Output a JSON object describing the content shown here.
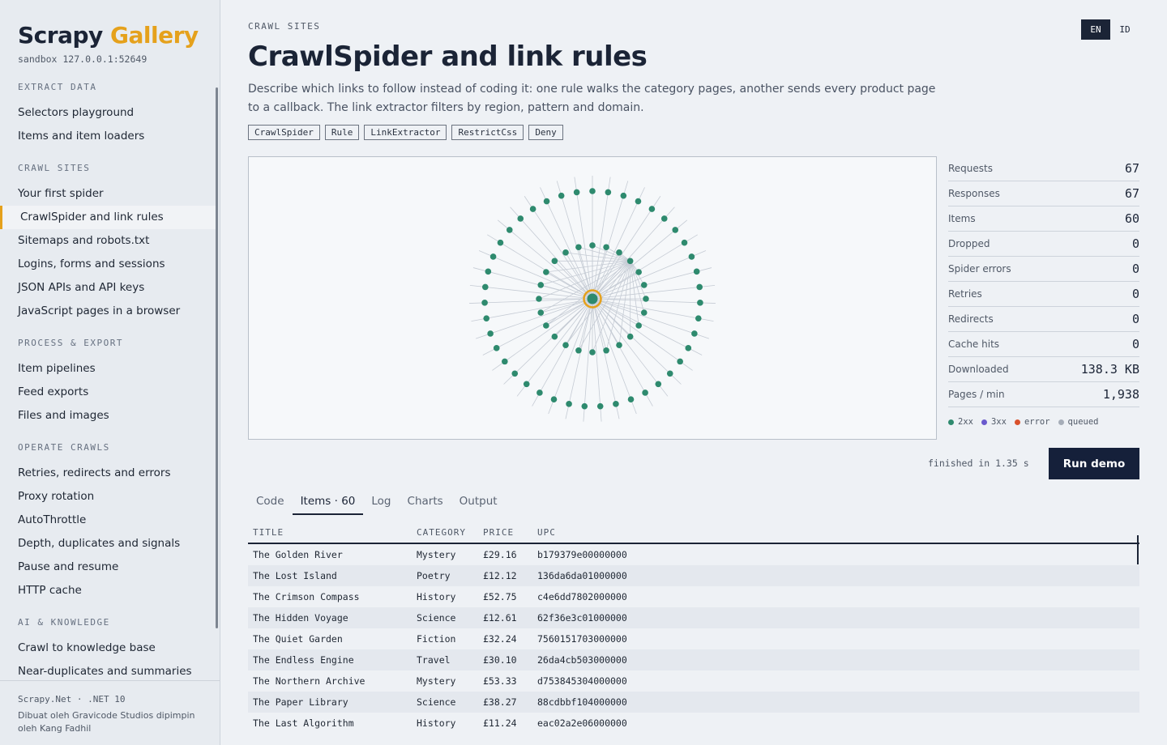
{
  "brand": {
    "name1": "Scrapy",
    "name2": "Gallery",
    "host": "sandbox 127.0.0.1:52649"
  },
  "nav": [
    {
      "section": "EXTRACT DATA",
      "items": [
        {
          "label": "Selectors playground",
          "active": false
        },
        {
          "label": "Items and item loaders",
          "active": false
        }
      ]
    },
    {
      "section": "CRAWL SITES",
      "items": [
        {
          "label": "Your first spider",
          "active": false
        },
        {
          "label": "CrawlSpider and link rules",
          "active": true
        },
        {
          "label": "Sitemaps and robots.txt",
          "active": false
        },
        {
          "label": "Logins, forms and sessions",
          "active": false
        },
        {
          "label": "JSON APIs and API keys",
          "active": false
        },
        {
          "label": "JavaScript pages in a browser",
          "active": false
        }
      ]
    },
    {
      "section": "PROCESS & EXPORT",
      "items": [
        {
          "label": "Item pipelines",
          "active": false
        },
        {
          "label": "Feed exports",
          "active": false
        },
        {
          "label": "Files and images",
          "active": false
        }
      ]
    },
    {
      "section": "OPERATE CRAWLS",
      "items": [
        {
          "label": "Retries, redirects and errors",
          "active": false
        },
        {
          "label": "Proxy rotation",
          "active": false
        },
        {
          "label": "AutoThrottle",
          "active": false
        },
        {
          "label": "Depth, duplicates and signals",
          "active": false
        },
        {
          "label": "Pause and resume",
          "active": false
        },
        {
          "label": "HTTP cache",
          "active": false
        }
      ]
    },
    {
      "section": "AI & KNOWLEDGE",
      "items": [
        {
          "label": "Crawl to knowledge base",
          "active": false
        },
        {
          "label": "Near-duplicates and summaries",
          "active": false
        }
      ]
    },
    {
      "section": "RUN AS A PLATFORM",
      "items": []
    }
  ],
  "footer": {
    "version": "Scrapy.Net · .NET 10",
    "credit": "Dibuat oleh Gravicode Studios dipimpin oleh Kang Fadhil"
  },
  "page": {
    "eyebrow": "CRAWL SITES",
    "title": "CrawlSpider and link rules",
    "description": "Describe which links to follow instead of coding it: one rule walks the category pages, another sends every product page to a callback. The link extractor filters by region, pattern and domain.",
    "tags": [
      "CrawlSpider",
      "Rule",
      "LinkExtractor",
      "RestrictCss",
      "Deny"
    ]
  },
  "lang": {
    "en": "EN",
    "id": "ID",
    "active": "EN"
  },
  "graph": {
    "inner_nodes": 24,
    "outer_nodes": 43,
    "colors": {
      "node": "#2e8a6e",
      "root_ring": "#e5a11c",
      "edge": "#c5cbd4"
    }
  },
  "stats": [
    {
      "label": "Requests",
      "value": "67"
    },
    {
      "label": "Responses",
      "value": "67"
    },
    {
      "label": "Items",
      "value": "60"
    },
    {
      "label": "Dropped",
      "value": "0"
    },
    {
      "label": "Spider errors",
      "value": "0"
    },
    {
      "label": "Retries",
      "value": "0"
    },
    {
      "label": "Redirects",
      "value": "0"
    },
    {
      "label": "Cache hits",
      "value": "0"
    },
    {
      "label": "Downloaded",
      "value": "138.3 KB"
    },
    {
      "label": "Pages / min",
      "value": "1,938"
    }
  ],
  "legend": [
    {
      "label": "2xx",
      "color": "#2e8a6e"
    },
    {
      "label": "3xx",
      "color": "#6a5acd"
    },
    {
      "label": "error",
      "color": "#d9512c"
    },
    {
      "label": "queued",
      "color": "#a6adb8"
    }
  ],
  "run": {
    "status": "finished in 1.35 s",
    "button": "Run demo"
  },
  "tabs": [
    {
      "label": "Code",
      "active": false
    },
    {
      "label": "Items · 60",
      "active": true
    },
    {
      "label": "Log",
      "active": false
    },
    {
      "label": "Charts",
      "active": false
    },
    {
      "label": "Output",
      "active": false
    }
  ],
  "table": {
    "columns": [
      "TITLE",
      "CATEGORY",
      "PRICE",
      "UPC"
    ],
    "rows": [
      [
        "The Golden River",
        "Mystery",
        "£29.16",
        "b179379e00000000"
      ],
      [
        "The Lost Island",
        "Poetry",
        "£12.12",
        "136da6da01000000"
      ],
      [
        "The Crimson Compass",
        "History",
        "£52.75",
        "c4e6dd7802000000"
      ],
      [
        "The Hidden Voyage",
        "Science",
        "£12.61",
        "62f36e3c01000000"
      ],
      [
        "The Quiet Garden",
        "Fiction",
        "£32.24",
        "7560151703000000"
      ],
      [
        "The Endless Engine",
        "Travel",
        "£30.10",
        "26da4cb503000000"
      ],
      [
        "The Northern Archive",
        "Mystery",
        "£53.33",
        "d753845304000000"
      ],
      [
        "The Paper Library",
        "Science",
        "£38.27",
        "88cdbbf104000000"
      ],
      [
        "The Last Algorithm",
        "History",
        "£11.24",
        "eac02a2e06000000"
      ]
    ]
  }
}
